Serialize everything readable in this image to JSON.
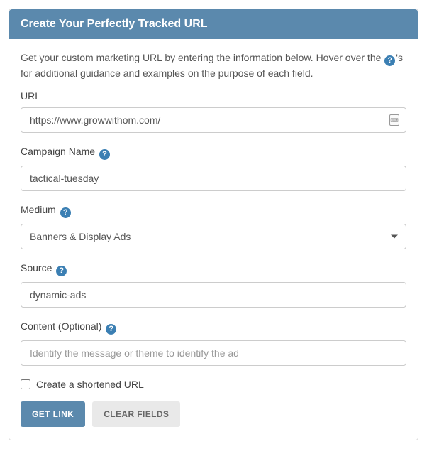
{
  "panel": {
    "title": "Create Your Perfectly Tracked URL",
    "intro_before": "Get your custom marketing URL by entering the information below. Hover over the ",
    "intro_after": "'s for additional guidance and examples on the purpose of each field."
  },
  "fields": {
    "url": {
      "label": "URL",
      "value": "https://www.growwithom.com/"
    },
    "campaign": {
      "label": "Campaign Name",
      "value": "tactical-tuesday"
    },
    "medium": {
      "label": "Medium",
      "value": "Banners & Display Ads"
    },
    "source": {
      "label": "Source",
      "value": "dynamic-ads"
    },
    "content": {
      "label": "Content (Optional)",
      "placeholder": "Identify the message or theme to identify the ad"
    }
  },
  "shorten": {
    "label": "Create a shortened URL",
    "checked": false
  },
  "buttons": {
    "submit": "GET LINK",
    "clear": "CLEAR FIELDS"
  },
  "colors": {
    "accent": "#5b89ad",
    "help": "#3b7fb3"
  }
}
